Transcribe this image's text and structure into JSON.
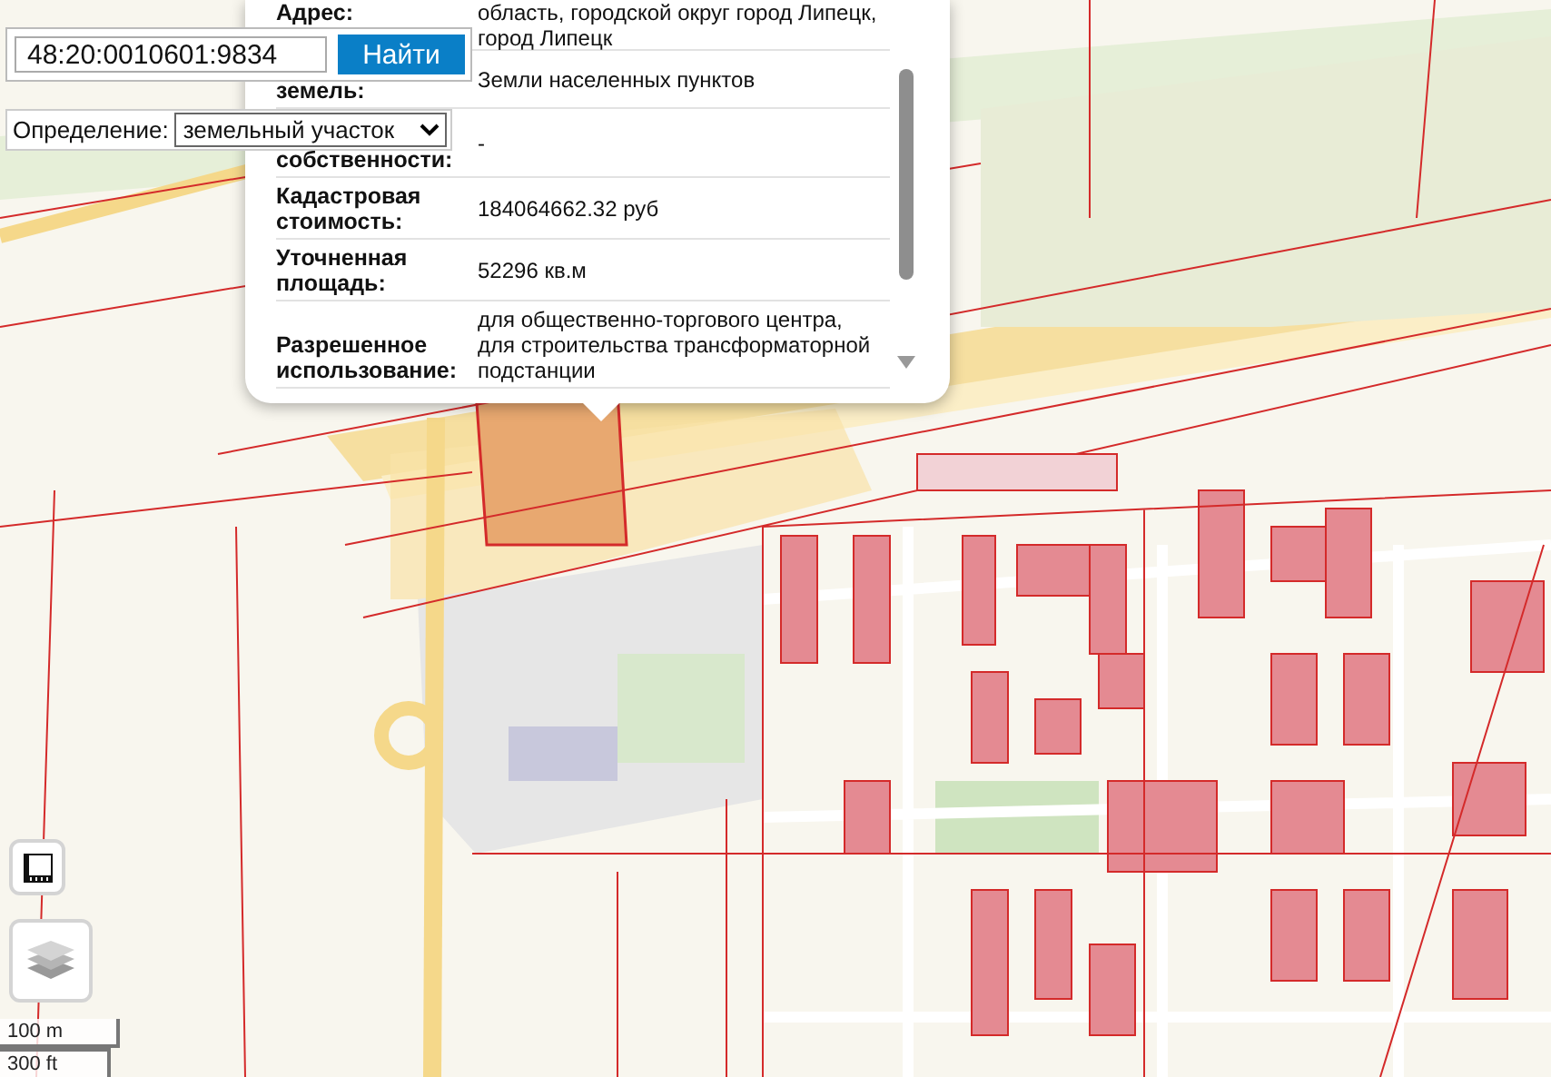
{
  "search": {
    "value": "48:20:0010601:9834",
    "button": "Найти"
  },
  "definition": {
    "label": "Определение:",
    "value": "земельный участок"
  },
  "popup": {
    "rows": [
      {
        "label": [
          "Адрес:"
        ],
        "value": [
          "область, городской округ город Липецк,",
          "город Липецк"
        ]
      },
      {
        "label": [
          "земель:"
        ],
        "value": [
          "Земли населенных пунктов"
        ]
      },
      {
        "label": [
          "собственности:"
        ],
        "value": [
          "-"
        ]
      },
      {
        "label": [
          "Кадастровая",
          "стоимость:"
        ],
        "value": [
          "184064662.32 руб"
        ]
      },
      {
        "label": [
          "Уточненная",
          "площадь:"
        ],
        "value": [
          "52296 кв.м"
        ]
      },
      {
        "label": [
          "Разрешенное",
          "использование:"
        ],
        "value": [
          "для общественно-торгового центра,",
          "для строительства трансформаторной",
          "подстанции"
        ]
      }
    ]
  },
  "scale": {
    "metric": "100 m",
    "imperial": "300 ft"
  }
}
